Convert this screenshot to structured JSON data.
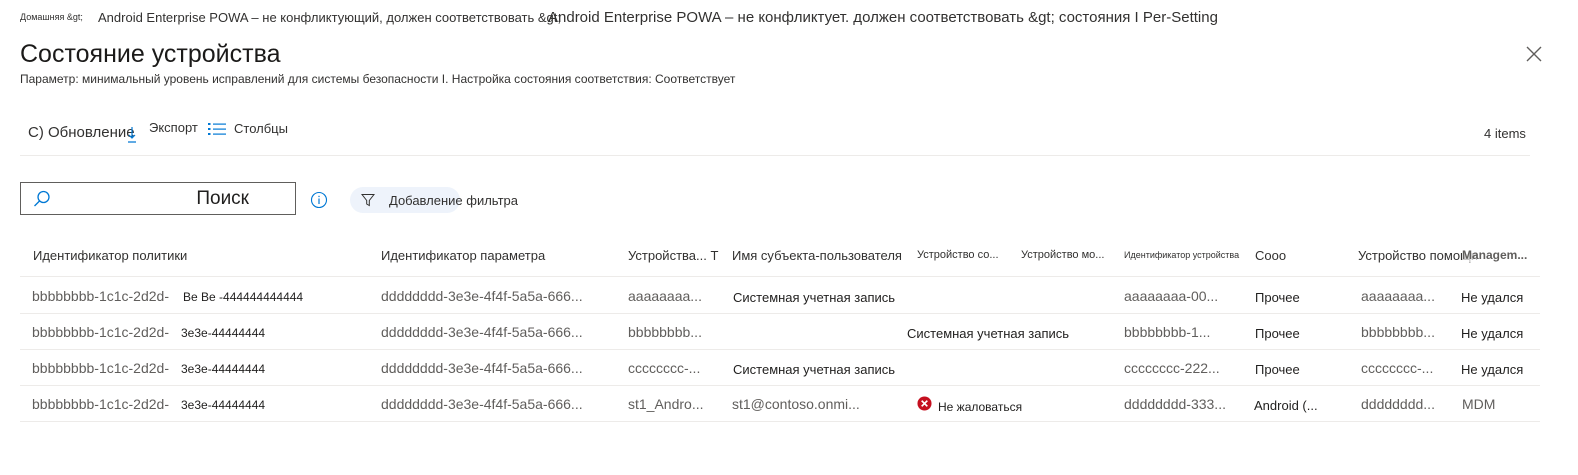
{
  "breadcrumb": {
    "home": "Домашняя &gt;",
    "item1": "Android Enterprise POWA – не конфликтующий, должен соответствовать &gt;",
    "item2": "Android Enterprise POWA – не конфликтует. должен соответствовать &gt; состояния I Per-Setting"
  },
  "page": {
    "title": "Состояние устройства",
    "subtitle": "Параметр: минимальный уровень исправлений для системы безопасности I. Настройка состояния соответствия: Соответствует"
  },
  "toolbar": {
    "refresh_label": "С) Обновление",
    "export_label": "Экспорт",
    "columns_label": "Столбцы",
    "items_count": "4 items"
  },
  "search": {
    "placeholder": "Поиск"
  },
  "filter": {
    "label": "Добавление фильтра"
  },
  "table": {
    "headers": {
      "policy_id": "Идентификатор политики",
      "setting_id": "Идентификатор параметра",
      "device": "Устройства... Т",
      "user_principal": "Имя субъекта-пользователя",
      "device_status": "Устройство со...",
      "device_model": "Устройство мо...",
      "device_id": "Идентификатор устройства",
      "os": "Сооо",
      "device_help": "Устройство помощи",
      "management": "Managem..."
    },
    "rows": [
      {
        "policy_prefix": "bbbbbbbb-1c1c-2d2d-",
        "policy_suffix": "Be Be -444444444444",
        "setting_id": "dddddddd-3e3e-4f4f-5a5a-666...",
        "device": "aaaaaaaa...",
        "user_principal": "Системная учетная запись",
        "status": "",
        "device_id": "aaaaaaaa-00...",
        "os": "Прочее",
        "device_help": "aaaaaaaa...",
        "management": "Не удался"
      },
      {
        "policy_prefix": "bbbbbbbb-1c1c-2d2d-",
        "policy_suffix": "3e3e-44444444",
        "setting_id": "dddddddd-3e3e-4f4f-5a5a-666...",
        "device": "bbbbbbbb...",
        "user_principal": "",
        "status": "Системная учетная запись",
        "device_id": "bbbbbbbb-1...",
        "os": "Прочее",
        "device_help": "bbbbbbbb...",
        "management": "Не удался"
      },
      {
        "policy_prefix": "bbbbbbbb-1c1c-2d2d-",
        "policy_suffix": "3e3e-44444444",
        "setting_id": "dddddddd-3e3e-4f4f-5a5a-666...",
        "device": "cccccccc-...",
        "user_principal": "Системная учетная запись",
        "status": "",
        "device_id": "cccccccc-222...",
        "os": "Прочее",
        "device_help": "cccccccc-...",
        "management": "Не удался"
      },
      {
        "policy_prefix": "bbbbbbbb-1c1c-2d2d-",
        "policy_suffix": "3e3e-44444444",
        "setting_id": "dddddddd-3e3e-4f4f-5a5a-666...",
        "device": "st1_Andro...",
        "user_principal": "st1@contoso.onmi...",
        "status": "Не жаловаться",
        "device_id": "dddddddd-333...",
        "os": "Android (...",
        "device_help": "dddddddd...",
        "management": "MDM"
      }
    ]
  },
  "colors": {
    "accent": "#0078d4",
    "error": "#c50f1f",
    "divider": "#edebe9"
  }
}
